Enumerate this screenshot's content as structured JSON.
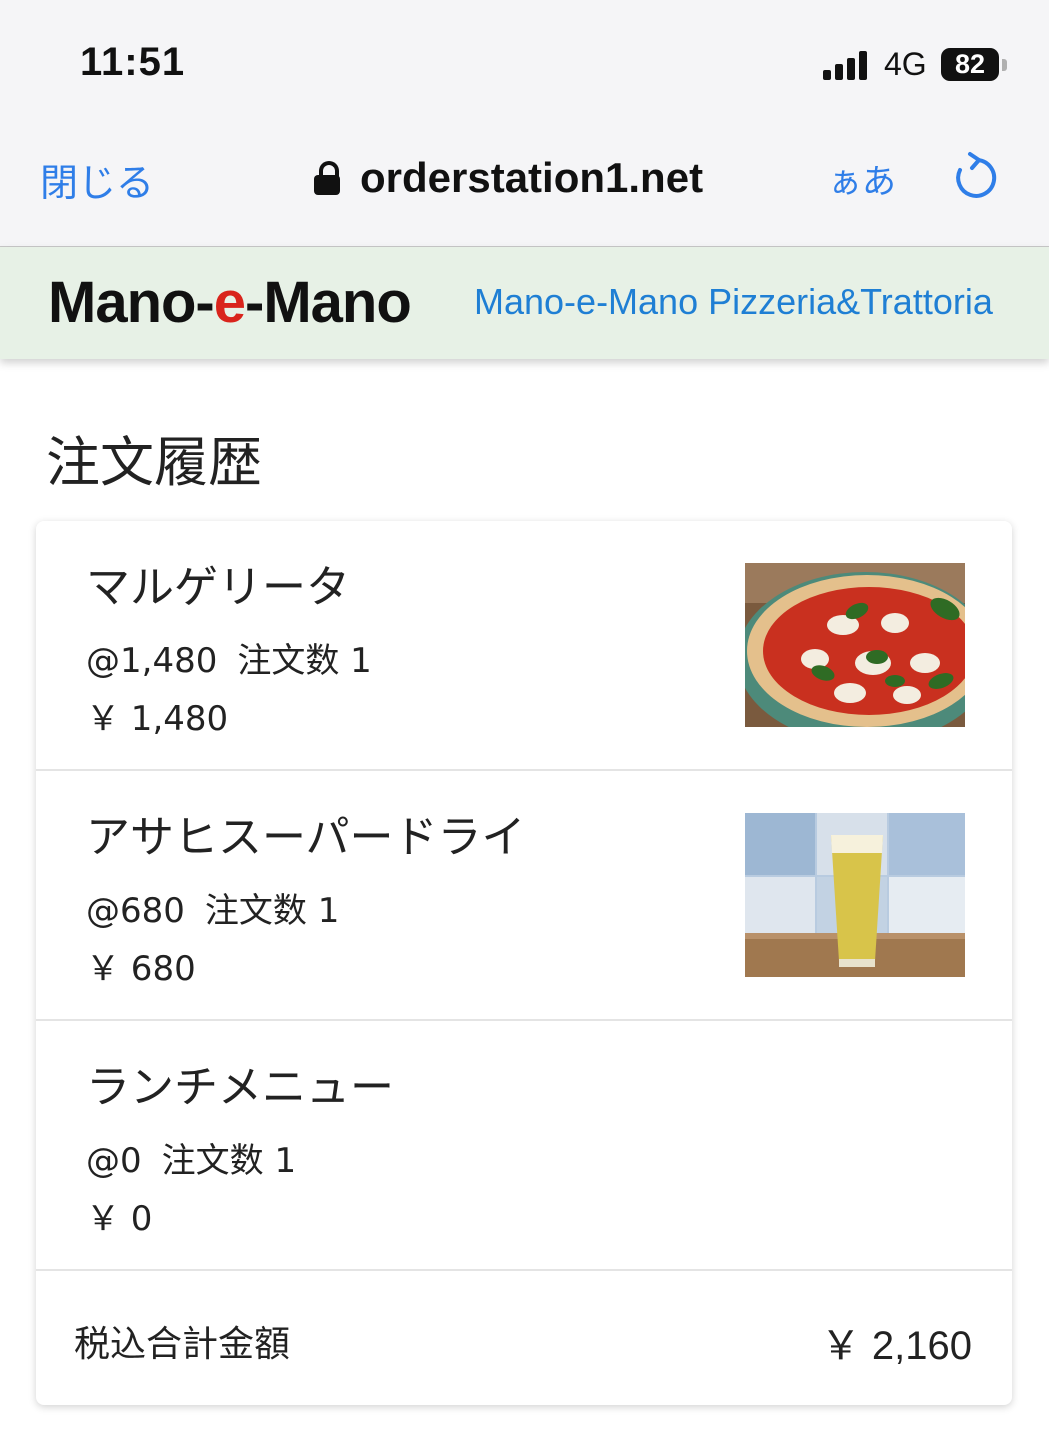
{
  "status_bar": {
    "time": "11:51",
    "network": "4G",
    "battery": "82"
  },
  "browser": {
    "close_label": "閉じる",
    "url": "orderstation1.net",
    "text_size_label": "ぁあ"
  },
  "header": {
    "logo_part1": "Mano-",
    "logo_part2": "e",
    "logo_part3": "-Mano",
    "site_name": "Mano-e-Mano Pizzeria&Trattoria"
  },
  "page": {
    "title": "注文履歴"
  },
  "order_items": [
    {
      "name": "マルゲリータ",
      "unit_price": "@1,480",
      "quantity_label": "注文数 1",
      "price": "￥ 1,480",
      "image": "pizza-photo"
    },
    {
      "name": "アサヒスーパードライ",
      "unit_price": "@680",
      "quantity_label": "注文数 1",
      "price": "￥ 680",
      "image": "beer-photo"
    },
    {
      "name": "ランチメニュー",
      "unit_price": "@0",
      "quantity_label": "注文数 1",
      "price": "￥ 0"
    }
  ],
  "total": {
    "label": "税込合計金額",
    "value": "￥ 2,160"
  },
  "colors": {
    "accent_blue": "#2f7ee8",
    "header_bg": "#e7f1e6",
    "logo_red": "#d9241c"
  }
}
